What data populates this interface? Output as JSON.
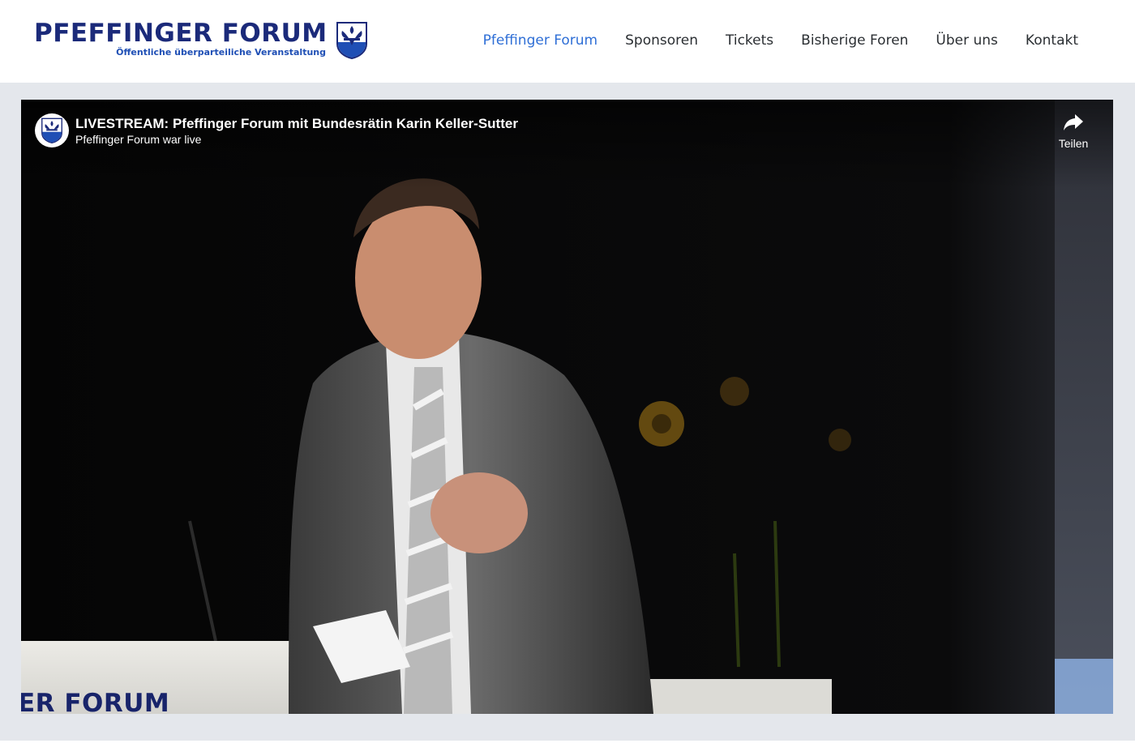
{
  "header": {
    "logo_title": "PFEFFINGER FORUM",
    "logo_subtitle": "Öffentliche überparteiliche Veranstaltung",
    "logo_icon": "shield-crest-icon",
    "nav": [
      {
        "label": "Pfeffinger Forum",
        "active": true
      },
      {
        "label": "Sponsoren",
        "active": false
      },
      {
        "label": "Tickets",
        "active": false
      },
      {
        "label": "Bisherige Foren",
        "active": false
      },
      {
        "label": "Über uns",
        "active": false
      },
      {
        "label": "Kontakt",
        "active": false
      }
    ]
  },
  "video": {
    "title": "LIVESTREAM: Pfeffinger Forum mit Bundesrätin Karin Keller-Sutter",
    "channel": "Pfeffinger Forum war live",
    "share_label": "Teilen",
    "share_icon": "share-arrow-icon",
    "podium_text": "ER FORUM"
  },
  "colors": {
    "brand_navy": "#1b2a7a",
    "brand_blue": "#1f4fb5",
    "nav_active": "#2f6fd6",
    "nav_text": "#2b2f33",
    "band_gray": "#e4e7ec",
    "video_bg": "#050505"
  }
}
